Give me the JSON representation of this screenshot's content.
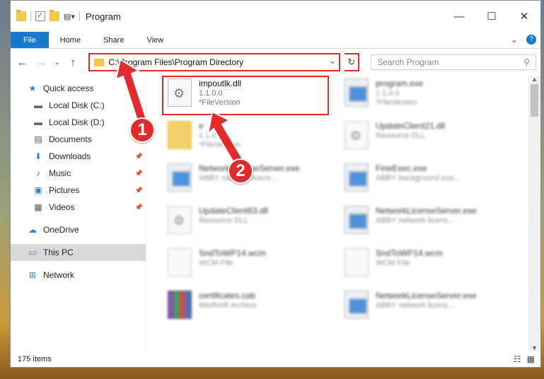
{
  "window": {
    "title": "Program",
    "controls": {
      "minimize": "—",
      "maximize": "☐",
      "close": "✕"
    }
  },
  "ribbon": {
    "tabs": [
      "File",
      "Home",
      "Share",
      "View"
    ],
    "help": "?"
  },
  "address": {
    "path": "C:\\Program Files\\Program Directory",
    "search_placeholder": "Search Program"
  },
  "sidebar": {
    "items": [
      {
        "label": "Quick access",
        "icon": "star-icon"
      },
      {
        "label": "Local Disk (C:)",
        "icon": "drive-icon"
      },
      {
        "label": "Local Disk (D:)",
        "icon": "drive-icon"
      },
      {
        "label": "Documents",
        "icon": "documents-icon"
      },
      {
        "label": "Downloads",
        "icon": "download-icon"
      },
      {
        "label": "Music",
        "icon": "music-icon"
      },
      {
        "label": "Pictures",
        "icon": "pictures-icon"
      },
      {
        "label": "Videos",
        "icon": "videos-icon"
      },
      {
        "label": "OneDrive",
        "icon": "cloud-icon"
      },
      {
        "label": "This PC",
        "icon": "computer-icon"
      },
      {
        "label": "Network",
        "icon": "network-icon"
      }
    ]
  },
  "files": [
    {
      "name": "impoutlk.dll",
      "line2": "1.1.0.0",
      "line3": "*FileVersion",
      "icon": "gear-file-icon",
      "highlighted": true
    },
    {
      "name": "program.exe",
      "line2": "1.1.0.0",
      "line3": "*FileVersion",
      "icon": "app-icon"
    },
    {
      "name": "e",
      "line2": "1.1.0.",
      "line3": "*FileVersion",
      "icon": "folder-icon"
    },
    {
      "name": "UpdateClient21.dll",
      "line2": "Resource DLL",
      "line3": "",
      "icon": "gear-file-icon"
    },
    {
      "name": "NetworkLicenseServer.exe",
      "line2": "ABBY network licens...",
      "line3": "",
      "icon": "app-icon"
    },
    {
      "name": "FineExec.exe",
      "line2": "ABBY background exe...",
      "line3": "",
      "icon": "app-icon"
    },
    {
      "name": "UpdateClient63.dll",
      "line2": "Resource DLL",
      "line3": "",
      "icon": "gear-file-icon"
    },
    {
      "name": "NetworkLicenseServer.exe",
      "line2": "ABBY network licens...",
      "line3": "",
      "icon": "app-icon"
    },
    {
      "name": "SndToWP14.wcm",
      "line2": "WCM File",
      "line3": "",
      "icon": "blank-file-icon"
    },
    {
      "name": "SndToWP14.wcm",
      "line2": "WCM File",
      "line3": "",
      "icon": "blank-file-icon"
    },
    {
      "name": "certificates.cab",
      "line2": "WinRAR Archive",
      "line3": "",
      "icon": "archive-icon"
    },
    {
      "name": "NetworkLicenseServer.exe",
      "line2": "ABBY network licens...",
      "line3": "",
      "icon": "app-icon"
    }
  ],
  "status": {
    "count": "175 items"
  },
  "annotations": {
    "badge1": "1",
    "badge2": "2"
  },
  "colors": {
    "accent": "#1979ca",
    "annotation": "#e22b2b"
  }
}
